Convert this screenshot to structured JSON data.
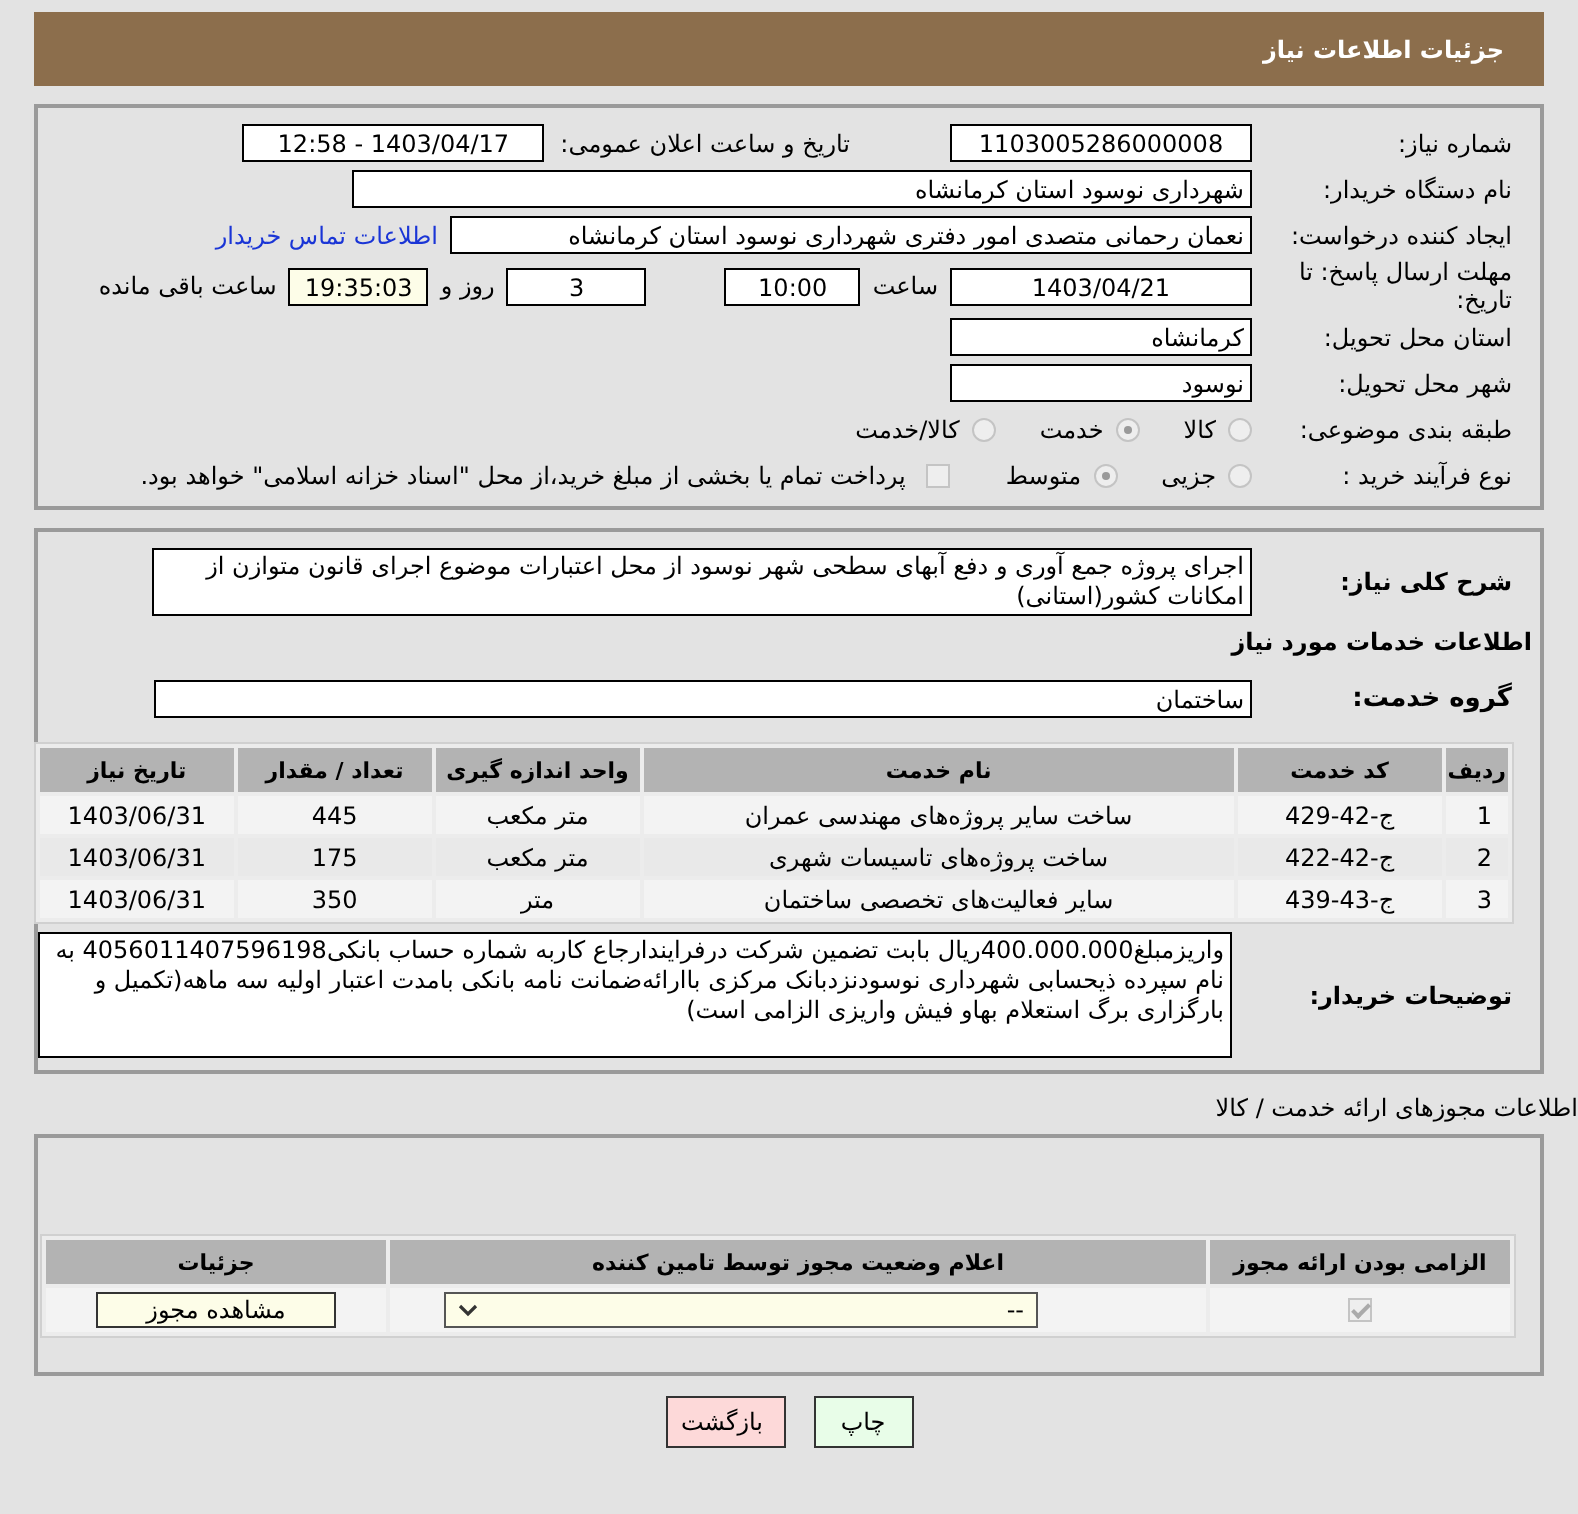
{
  "header": {
    "title": "جزئیات اطلاعات نیاز"
  },
  "details": {
    "need_number": {
      "label": "شماره نیاز:",
      "value": "1103005286000008"
    },
    "announce": {
      "label": "تاریخ و ساعت اعلان عمومی:",
      "value": "1403/04/17 - 12:58"
    },
    "buyer": {
      "label": "نام دستگاه خریدار:",
      "value": "شهرداری نوسود استان کرمانشاه"
    },
    "creator": {
      "label": "ایجاد کننده درخواست:",
      "value": "نعمان رحمانی متصدی امور دفتری شهرداری نوسود استان کرمانشاه",
      "link": "اطلاعات تماس خریدار"
    },
    "deadline": {
      "label": "مهلت ارسال پاسخ: تا تاریخ:",
      "date": "1403/04/21",
      "time_label": "ساعت",
      "time": "10:00",
      "days": "3",
      "days_label": "روز و",
      "remaining": "19:35:03",
      "remaining_label": "ساعت باقی مانده"
    },
    "province": {
      "label": "استان محل تحویل:",
      "value": "کرمانشاه"
    },
    "city": {
      "label": "شهر محل تحویل:",
      "value": "نوسود"
    },
    "category": {
      "label": "طبقه بندی موضوعی:",
      "options": [
        {
          "label": "کالا",
          "selected": false
        },
        {
          "label": "خدمت",
          "selected": true
        },
        {
          "label": "کالا/خدمت",
          "selected": false
        }
      ]
    },
    "purchase_type": {
      "label": "نوع فرآیند خرید :",
      "options": [
        {
          "label": "جزیی",
          "selected": false
        },
        {
          "label": "متوسط",
          "selected": true
        }
      ],
      "treasury": {
        "checked": false,
        "label": "پرداخت تمام یا بخشی از مبلغ خرید،از محل \"اسناد خزانه اسلامی\" خواهد بود."
      }
    }
  },
  "services": {
    "description": {
      "label": "شرح کلی نیاز:",
      "value": "اجرای پروژه جمع آوری و دفع آبهای سطحی شهر نوسود از محل اعتبارات موضوع اجرای قانون متوازن از امکانات کشور(استانی)"
    },
    "heading": "اطلاعات خدمات مورد نیاز",
    "group": {
      "label": "گروه خدمت:",
      "value": "ساختمان"
    },
    "table": {
      "columns": [
        "ردیف",
        "کد خدمت",
        "نام خدمت",
        "واحد اندازه گیری",
        "تعداد / مقدار",
        "تاریخ نیاز"
      ],
      "rows": [
        [
          "1",
          "ج-42-429",
          "ساخت سایر پروژه‌های مهندسی عمران",
          "متر مکعب",
          "445",
          "1403/06/31"
        ],
        [
          "2",
          "ج-42-422",
          "ساخت پروژه‌های تاسیسات شهری",
          "متر مکعب",
          "175",
          "1403/06/31"
        ],
        [
          "3",
          "ج-43-439",
          "سایر فعالیت‌های تخصصی ساختمان",
          "متر",
          "350",
          "1403/06/31"
        ]
      ]
    },
    "notes": {
      "label": "توضیحات خریدار:",
      "value": "واریزمبلغ400.000.000ریال بابت تضمین شرکت درفرایندارجاع کاربه شماره حساب بانکی4056011407596198 به نام سپرده ذیحسابی شهرداری نوسودنزدبانک مرکزی باارائه‌ضمانت نامه بانکی بامدت اعتبار اولیه سه ماهه(تکمیل و بارگزاری برگ استعلام بهاو فیش واریزی الزامی است)"
    }
  },
  "permits": {
    "title": "اطلاعات مجوزهای ارائه خدمت / کالا",
    "columns": [
      "الزامی بودن ارائه مجوز",
      "اعلام وضعیت مجوز توسط تامین کننده",
      "جزئیات"
    ],
    "rows": [
      {
        "required": true,
        "status": "--",
        "details_button": "مشاهده مجوز"
      }
    ]
  },
  "buttons": [
    {
      "label": "چاپ",
      "kind": "print"
    },
    {
      "label": "بازگشت",
      "kind": "back"
    }
  ]
}
